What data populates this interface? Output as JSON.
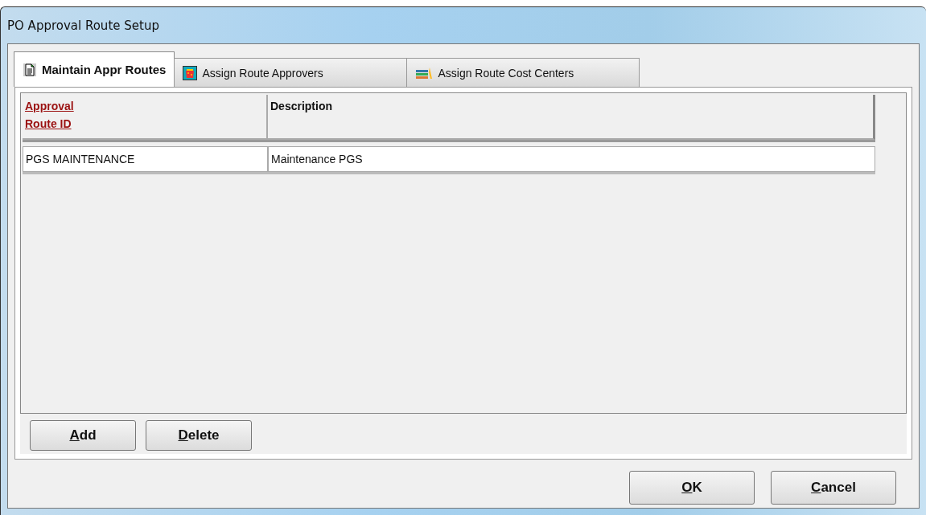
{
  "window": {
    "title": "PO Approval Route Setup"
  },
  "tabs": [
    {
      "label": "Maintain Appr Routes",
      "kind": "document",
      "selected": true
    },
    {
      "label": "Assign Route Approvers",
      "kind": "basket",
      "selected": false
    },
    {
      "label": "Assign Route Cost Centers",
      "kind": "books",
      "selected": false
    }
  ],
  "table": {
    "columns": [
      {
        "label": "Approval Route ID",
        "sortable": true
      },
      {
        "label": "Description",
        "sortable": false
      }
    ],
    "rows": [
      [
        "PGS MAINTENANCE",
        "Maintenance PGS"
      ]
    ]
  },
  "panel_buttons": [
    "Add",
    "Delete"
  ],
  "dialog_buttons": [
    "OK",
    "Cancel"
  ]
}
